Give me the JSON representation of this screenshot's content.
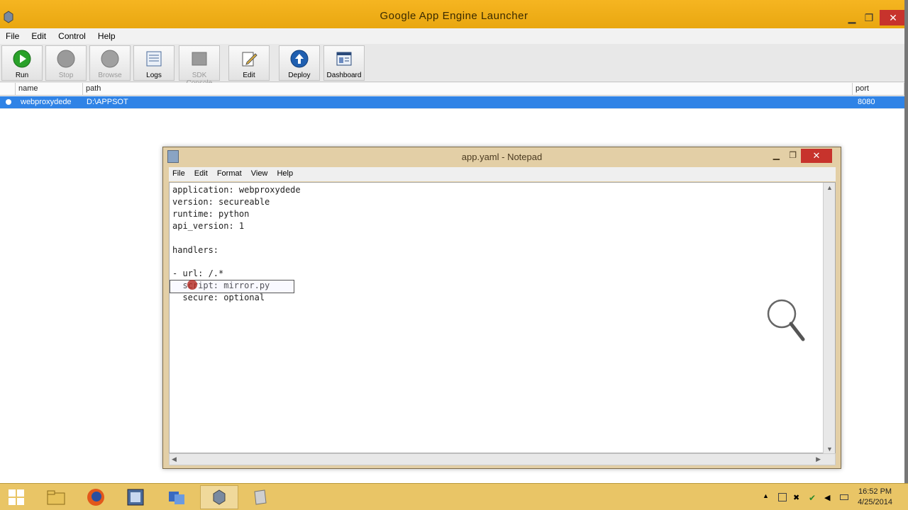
{
  "window": {
    "title": "Google App Engine Launcher"
  },
  "menu": [
    "File",
    "Edit",
    "Control",
    "Help"
  ],
  "toolbar": {
    "run": "Run",
    "stop": "Stop",
    "browse": "Browse",
    "logs": "Logs",
    "sdk_console": "SDK Console",
    "edit": "Edit",
    "deploy": "Deploy",
    "dashboard": "Dashboard"
  },
  "table": {
    "headers": {
      "name": "name",
      "path": "path",
      "port": "port"
    },
    "rows": [
      {
        "name": "webproxydede",
        "path": "D:\\APPSOT",
        "port": "8080"
      }
    ]
  },
  "notepad": {
    "title": "app.yaml - Notepad",
    "menu": [
      "File",
      "Edit",
      "Format",
      "View",
      "Help"
    ],
    "close": "✕",
    "lines": [
      "application: webproxydede",
      "version: secureable",
      "runtime: python",
      "api_version: 1",
      "",
      "handlers:",
      "",
      "- url: /.*",
      "  script: mirror.py",
      "  secure: optional"
    ]
  },
  "taskbar": {
    "time": "16:52 PM",
    "date": "4/25/2014"
  },
  "colors": {
    "title_bar": "#f0b01a",
    "selection": "#2f83e6",
    "close": "#c7332c",
    "taskbar": "#e9c566"
  }
}
